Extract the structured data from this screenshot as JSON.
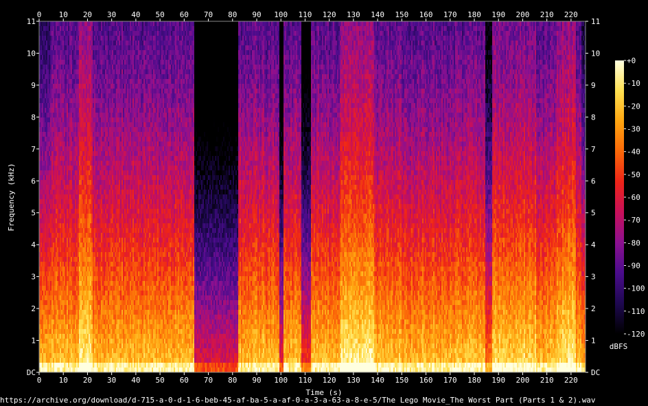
{
  "chart_data": {
    "type": "heatmap",
    "title": "",
    "xlabel": "Time (s)",
    "ylabel": "Frequency (kHz)",
    "xlim": [
      0,
      226
    ],
    "ylim": [
      0,
      11
    ],
    "x_ticks": [
      0,
      10,
      20,
      30,
      40,
      50,
      60,
      70,
      80,
      90,
      100,
      110,
      120,
      130,
      140,
      150,
      160,
      170,
      180,
      190,
      200,
      210,
      220
    ],
    "y_ticks": [
      "DC",
      "1",
      "2",
      "3",
      "4",
      "5",
      "6",
      "7",
      "8",
      "9",
      "10",
      "11"
    ],
    "colorbar": {
      "label": "dBFS",
      "range": [
        -120,
        0
      ],
      "ticks": [
        "+0",
        "-10",
        "-20",
        "-30",
        "-40",
        "-50",
        "-60",
        "-70",
        "-80",
        "-90",
        "-100",
        "-110",
        "-120"
      ],
      "colors": [
        "#000000",
        "#1e0850",
        "#4a0c8c",
        "#8c1090",
        "#c8105a",
        "#ee2418",
        "#fb6808",
        "#ffa510",
        "#ffe050",
        "#ffffe0"
      ]
    }
  },
  "source_url": "https://archive.org/download/d-715-a-0-d-1-6-beb-45-af-ba-5-a-af-0-a-3-a-63-a-8-e-5/The Lego Movie_The Worst Part (Parts 1 & 2).wav"
}
